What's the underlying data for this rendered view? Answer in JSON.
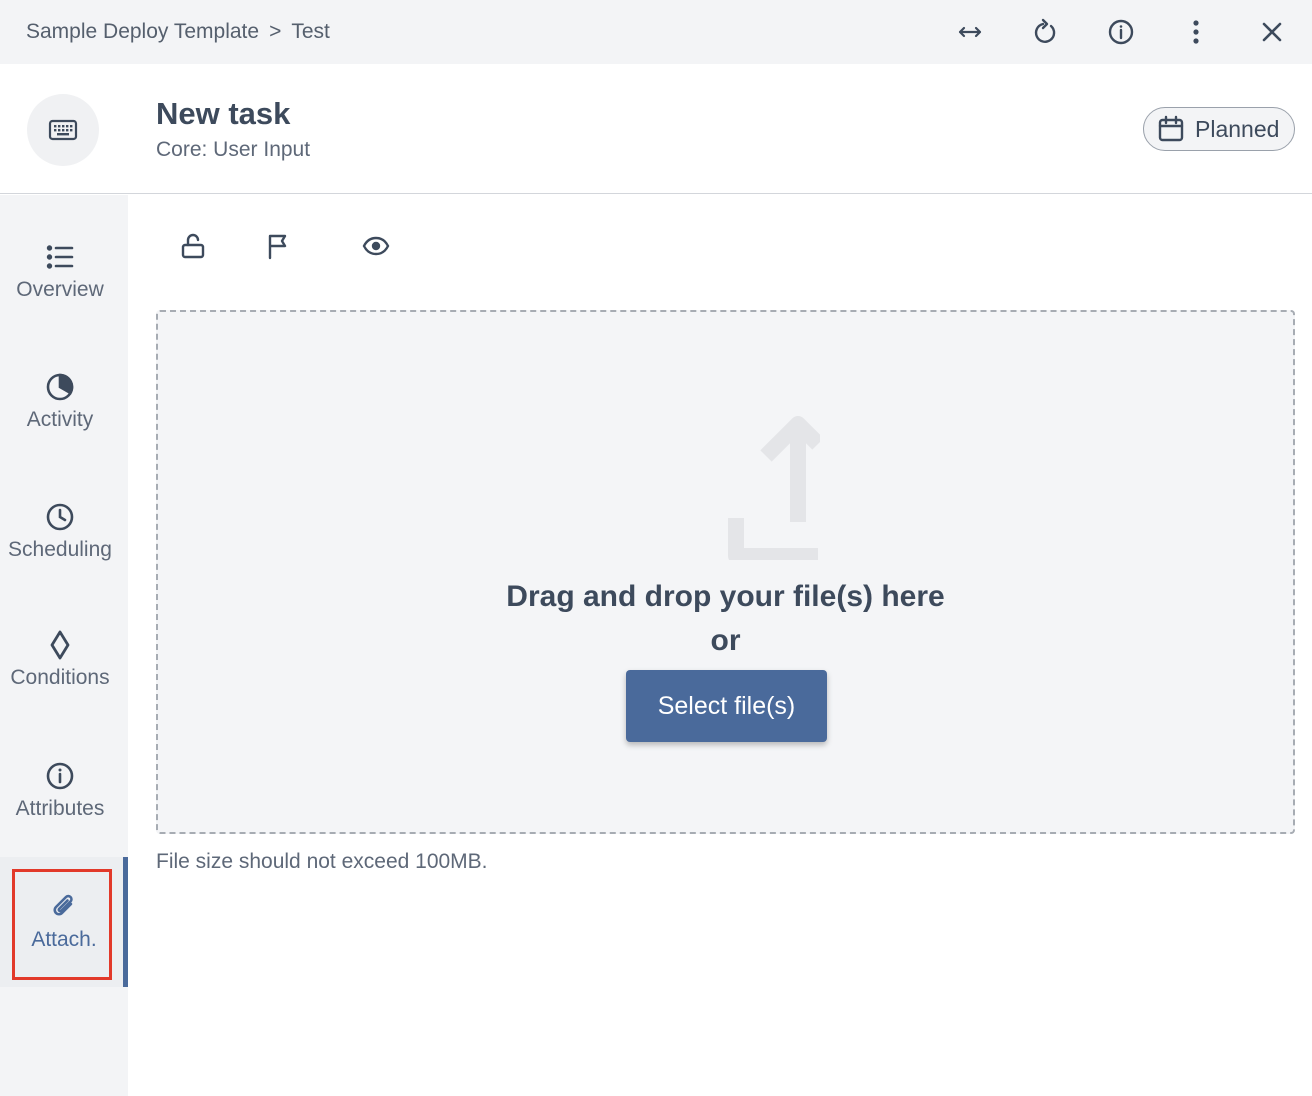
{
  "breadcrumb": {
    "parent": "Sample Deploy Template",
    "separator": ">",
    "current": "Test"
  },
  "top_actions": [
    "expand-icon",
    "refresh-icon",
    "info-icon",
    "more-vertical-icon",
    "close-icon"
  ],
  "header": {
    "title": "New task",
    "subtitle": "Core: User Input",
    "status": "Planned"
  },
  "sidebar": {
    "items": [
      {
        "label": "Overview",
        "icon": "list-icon"
      },
      {
        "label": "Activity",
        "icon": "pie-clock-icon"
      },
      {
        "label": "Scheduling",
        "icon": "clock-icon"
      },
      {
        "label": "Conditions",
        "icon": "diamond-icon"
      },
      {
        "label": "Attributes",
        "icon": "info-icon"
      },
      {
        "label": "Attach.",
        "icon": "paperclip-icon",
        "active": true
      }
    ]
  },
  "toolbar": [
    "unlock-icon",
    "flag-icon",
    "eye-icon"
  ],
  "dropzone": {
    "text": "Drag and drop your file(s) here",
    "or": "or",
    "button": "Select file(s)",
    "hint": "File size should not exceed 100MB."
  },
  "colors": {
    "accent": "#4a6a9b",
    "highlight": "#e2392a",
    "sidebar_bg": "#f3f4f6"
  }
}
